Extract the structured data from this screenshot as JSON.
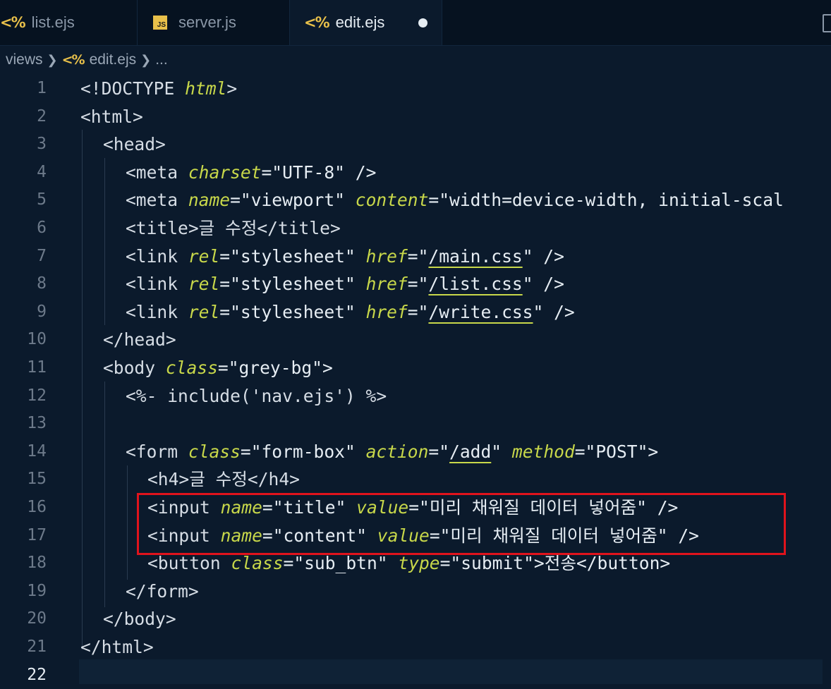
{
  "tabs": [
    {
      "label": "list.ejs",
      "icon": "ejs-icon"
    },
    {
      "label": "server.js",
      "icon": "js-icon",
      "icon_text": "JS"
    },
    {
      "label": "edit.ejs",
      "icon": "ejs-icon",
      "active": true,
      "unsaved": true
    }
  ],
  "ejs_icon_glyph": "<%",
  "breadcrumb": {
    "folder": "views",
    "file": "edit.ejs",
    "more": "..."
  },
  "current_line": 22,
  "colors": {
    "attribute": "#c8d84a",
    "highlight_box": "#e0131c",
    "ejs_icon": "#e8c04a"
  },
  "code": {
    "l1": {
      "ln": "1",
      "a": "<!DOCTYPE ",
      "b": "html",
      "c": ">"
    },
    "l2": {
      "ln": "2",
      "a": "<html>"
    },
    "l3": {
      "ln": "3",
      "a": "<head>"
    },
    "l4": {
      "ln": "4",
      "a": "<meta ",
      "b": "charset",
      "c": "=\"UTF-8\" />"
    },
    "l5": {
      "ln": "5",
      "a": "<meta ",
      "b": "name",
      "c": "=\"viewport\" ",
      "d": "content",
      "e": "=\"width=device-width, initial-scal"
    },
    "l6": {
      "ln": "6",
      "a": "<title>글 수정</title>"
    },
    "l7": {
      "ln": "7",
      "a": "<link ",
      "b": "rel",
      "c": "=\"stylesheet\" ",
      "d": "href",
      "e": "=\"",
      "f": "/main.css",
      "g": "\" />"
    },
    "l8": {
      "ln": "8",
      "a": "<link ",
      "b": "rel",
      "c": "=\"stylesheet\" ",
      "d": "href",
      "e": "=\"",
      "f": "/list.css",
      "g": "\" />"
    },
    "l9": {
      "ln": "9",
      "a": "<link ",
      "b": "rel",
      "c": "=\"stylesheet\" ",
      "d": "href",
      "e": "=\"",
      "f": "/write.css",
      "g": "\" />"
    },
    "l10": {
      "ln": "10",
      "a": "</head>"
    },
    "l11": {
      "ln": "11",
      "a": "<body ",
      "b": "class",
      "c": "=\"grey-bg\">"
    },
    "l12": {
      "ln": "12",
      "a": "<%- include('nav.ejs') %>"
    },
    "l13": {
      "ln": "13"
    },
    "l14": {
      "ln": "14",
      "a": "<form ",
      "b": "class",
      "c": "=\"form-box\" ",
      "d": "action",
      "e": "=\"",
      "f": "/add",
      "g": "\" ",
      "h": "method",
      "i": "=\"POST\">"
    },
    "l15": {
      "ln": "15",
      "a": "<h4>글 수정</h4>"
    },
    "l16": {
      "ln": "16",
      "a": "<input ",
      "b": "name",
      "c": "=\"title\" ",
      "d": "value",
      "e": "=\"미리 채워질 데이터 넣어줌\" />"
    },
    "l17": {
      "ln": "17",
      "a": "<input ",
      "b": "name",
      "c": "=\"content\" ",
      "d": "value",
      "e": "=\"미리 채워질 데이터 넣어줌\" />"
    },
    "l18": {
      "ln": "18",
      "a": "<button ",
      "b": "class",
      "c": "=\"sub_btn\" ",
      "d": "type",
      "e": "=\"submit\">전송</button>"
    },
    "l19": {
      "ln": "19",
      "a": "</form>"
    },
    "l20": {
      "ln": "20",
      "a": "</body>"
    },
    "l21": {
      "ln": "21",
      "a": "</html>"
    },
    "l22": {
      "ln": "22"
    }
  }
}
